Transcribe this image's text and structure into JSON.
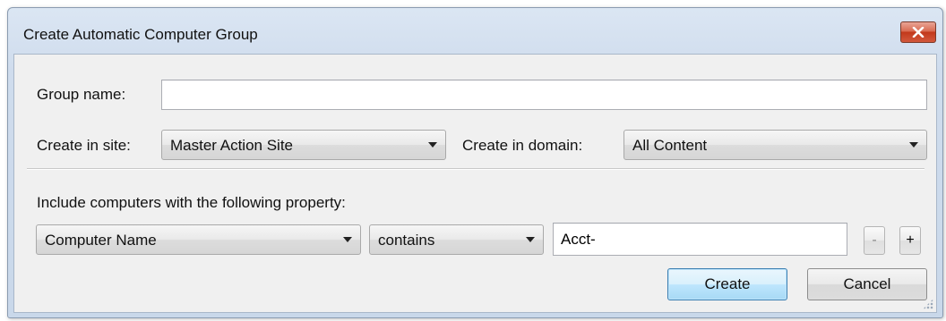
{
  "window": {
    "title": "Create Automatic Computer Group"
  },
  "form": {
    "group_name_label": "Group name:",
    "group_name_value": "",
    "create_in_site_label": "Create in site:",
    "site_selected": "Master Action Site",
    "create_in_domain_label": "Create in domain:",
    "domain_selected": "All Content",
    "property_heading": "Include computers with the following property:",
    "property_selected": "Computer Name",
    "operator_selected": "contains",
    "value_text": "Acct-",
    "remove_label": "-",
    "add_label": "+"
  },
  "buttons": {
    "create_label": "Create",
    "cancel_label": "Cancel"
  },
  "colors": {
    "close_button": "#c2391c",
    "default_button_border": "#3c7fb1",
    "frame": "#cfdced"
  }
}
